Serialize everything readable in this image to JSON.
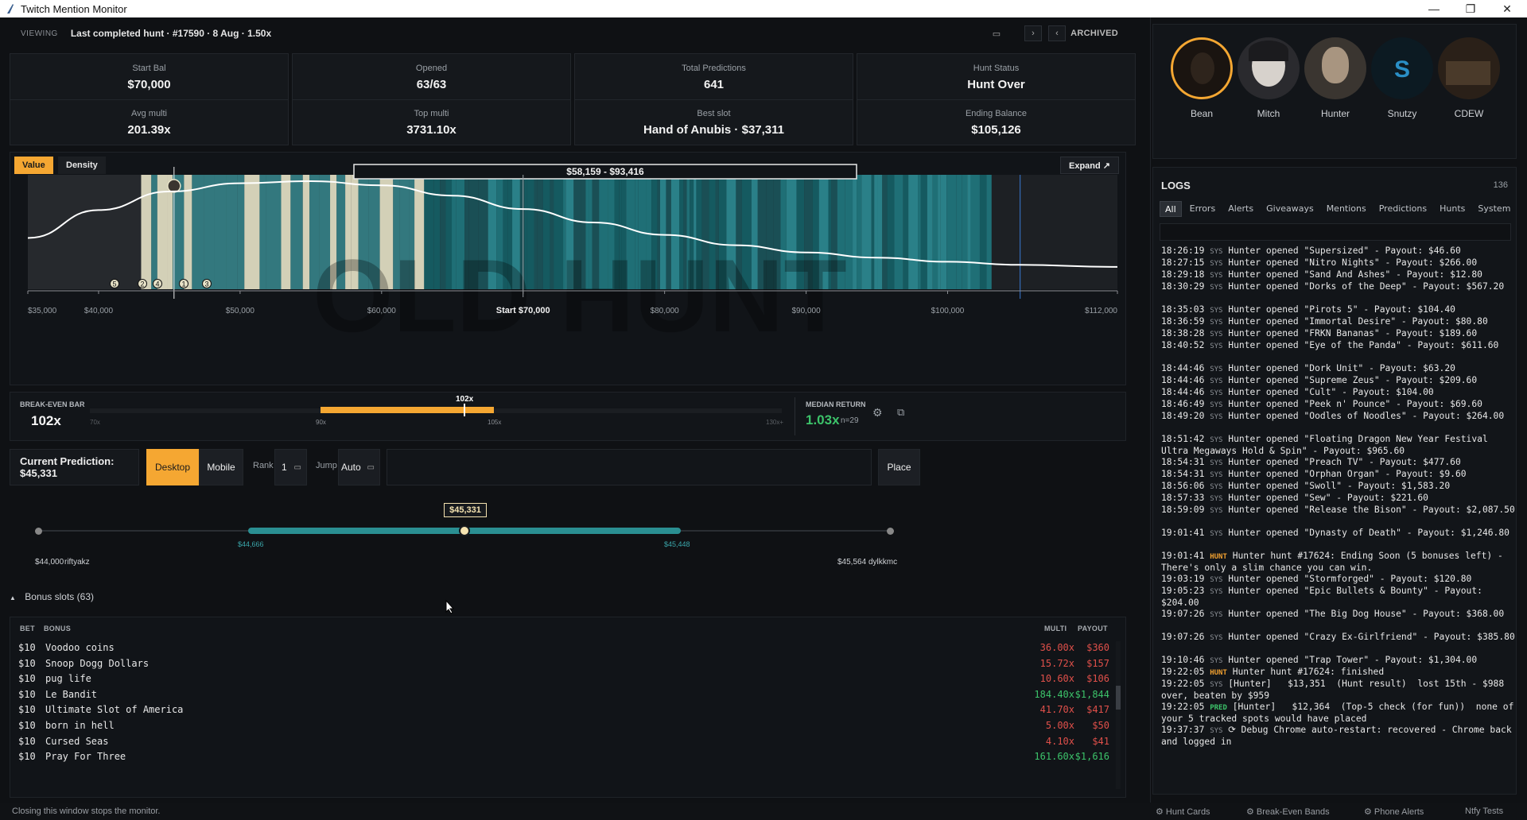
{
  "window": {
    "title": "Twitch Mention Monitor"
  },
  "viewing": {
    "label": "VIEWING",
    "text": "Last completed hunt · #17590 · 8 Aug · 1.50x",
    "archived": "ARCHIVED"
  },
  "stats": [
    {
      "k1": "Start Bal",
      "v1": "$70,000",
      "k2": "Avg multi",
      "v2": "201.39x"
    },
    {
      "k1": "Opened",
      "v1": "63/63",
      "k2": "Top multi",
      "v2": "3731.10x"
    },
    {
      "k1": "Total Predictions",
      "v1": "641",
      "k2": "Best slot",
      "v2": "Hand of Anubis · $37,311"
    },
    {
      "k1": "Hunt Status",
      "v1": "Hunt Over",
      "k2": "Ending Balance",
      "v2": "$105,126"
    }
  ],
  "chart": {
    "toggle_value": "Value",
    "toggle_density": "Density",
    "expand": "Expand ↗",
    "range_label": "$58,159 - $93,416",
    "watermark": "OLD HUNT",
    "ticks": [
      "$35,000",
      "$40,000",
      "$50,000",
      "$60,000",
      "Start $70,000",
      "$80,000",
      "$90,000",
      "$100,000",
      "$112,000"
    ],
    "markers": [
      "5",
      "2",
      "4",
      "1",
      "3"
    ]
  },
  "chart_data": {
    "type": "area",
    "title": "",
    "xlabel": "",
    "ylabel": "",
    "x_range": [
      35000,
      112000
    ],
    "x": [
      35000,
      40000,
      45000,
      50000,
      55000,
      60000,
      65000,
      70000,
      75000,
      80000,
      85000,
      90000,
      95000,
      100000,
      105000,
      112000
    ],
    "series": [
      {
        "values": [
          0.45,
          0.72,
          0.9,
          0.98,
          1.0,
          0.96,
          0.86,
          0.73,
          0.6,
          0.48,
          0.38,
          0.31,
          0.26,
          0.22,
          0.19,
          0.17
        ]
      }
    ],
    "highlight_range": [
      58159,
      93416
    ],
    "start_value": 70000,
    "grid": false
  },
  "breakeven": {
    "label": "BREAK-EVEN BAR",
    "value": "102x",
    "marker": "102x",
    "t1": "70x",
    "t2": "90x",
    "t3": "105x",
    "t4": "130x+",
    "median_label": "MEDIAN RETURN",
    "median_value": "1.03x",
    "median_n": "n=29"
  },
  "prediction": {
    "current": "Current Prediction: $45,331",
    "desktop": "Desktop",
    "mobile": "Mobile",
    "rank_label": "Rank",
    "rank_value": "1",
    "jump_label": "Jump",
    "jump_value": "Auto",
    "input_value": "",
    "place": "Place"
  },
  "slider": {
    "bubble": "$45,331",
    "low_mark": "$44,666",
    "high_mark": "$45,448",
    "left_val": "$44,000",
    "left_user": "riftyakz",
    "right_val": "$45,564",
    "right_user": "dylkkmc",
    "position": 0.5
  },
  "bonus": {
    "header": "Bonus slots",
    "count": "(63)",
    "cols": {
      "bet": "BET",
      "bonus": "BONUS",
      "multi": "MULTI",
      "payout": "PAYOUT"
    },
    "rows": [
      {
        "bet": "$10",
        "name": "Voodoo coins",
        "multi": "36.00x",
        "payout": "$360",
        "good": false
      },
      {
        "bet": "$10",
        "name": "Snoop Dogg Dollars",
        "multi": "15.72x",
        "payout": "$157",
        "good": false
      },
      {
        "bet": "$10",
        "name": "pug life",
        "multi": "10.60x",
        "payout": "$106",
        "good": false
      },
      {
        "bet": "$10",
        "name": "Le Bandit",
        "multi": "184.40x",
        "payout": "$1,844",
        "good": true
      },
      {
        "bet": "$10",
        "name": "Ultimate Slot of America",
        "multi": "41.70x",
        "payout": "$417",
        "good": false
      },
      {
        "bet": "$10",
        "name": "born in hell",
        "multi": "5.00x",
        "payout": "$50",
        "good": false
      },
      {
        "bet": "$10",
        "name": "Cursed Seas",
        "multi": "4.10x",
        "payout": "$41",
        "good": false
      },
      {
        "bet": "$10",
        "name": "Pray For Three",
        "multi": "161.60x",
        "payout": "$1,616",
        "good": true
      }
    ]
  },
  "footer": {
    "note": "Closing this window stops the monitor.",
    "links": [
      "Hunt Cards",
      "Break-Even Bands",
      "Phone Alerts",
      "Ntfy Tests"
    ]
  },
  "avatars": [
    {
      "name": "Bean",
      "active": true,
      "color": "#1a1410"
    },
    {
      "name": "Mitch",
      "active": false,
      "color": "#2a2a2e"
    },
    {
      "name": "Hunter",
      "active": false,
      "color": "#3a3530"
    },
    {
      "name": "Snutzy",
      "active": false,
      "color": "#0c1a22"
    },
    {
      "name": "CDEW",
      "active": false,
      "color": "#2a2018"
    }
  ],
  "logs": {
    "title": "LOGS",
    "count": "136",
    "tabs": [
      "All",
      "Errors",
      "Alerts",
      "Giveaways",
      "Mentions",
      "Predictions",
      "Hunts",
      "System"
    ],
    "lines": [
      {
        "time": "18:26:19",
        "tag": "SYS",
        "text": "Hunter opened \"Supersized\" - Payout: $46.60"
      },
      {
        "time": "18:27:15",
        "tag": "SYS",
        "text": "Hunter opened \"Nitro Nights\" - Payout: $266.00"
      },
      {
        "time": "18:29:18",
        "tag": "SYS",
        "text": "Hunter opened \"Sand And Ashes\" - Payout: $12.80"
      },
      {
        "time": "18:30:29",
        "tag": "SYS",
        "text": "Hunter opened \"Dorks of the Deep\" - Payout: $567.20"
      },
      {
        "time": "18:35:03",
        "tag": "SYS",
        "text": "Hunter opened \"Pirots 5\" - Payout: $104.40"
      },
      {
        "time": "18:36:59",
        "tag": "SYS",
        "text": "Hunter opened \"Immortal Desire\" - Payout: $80.80"
      },
      {
        "time": "18:38:28",
        "tag": "SYS",
        "text": "Hunter opened \"FRKN Bananas\" - Payout: $189.60"
      },
      {
        "time": "18:40:52",
        "tag": "SYS",
        "text": "Hunter opened \"Eye of the Panda\" - Payout: $611.60"
      },
      {
        "time": "18:44:46",
        "tag": "SYS",
        "text": "Hunter opened \"Dork Unit\" - Payout: $63.20"
      },
      {
        "time": "18:44:46",
        "tag": "SYS",
        "text": "Hunter opened \"Supreme Zeus\" - Payout: $209.60"
      },
      {
        "time": "18:44:46",
        "tag": "SYS",
        "text": "Hunter opened \"Cult\" - Payout: $104.00"
      },
      {
        "time": "18:46:49",
        "tag": "SYS",
        "text": "Hunter opened \"Peek n' Pounce\" - Payout: $69.60"
      },
      {
        "time": "18:49:20",
        "tag": "SYS",
        "text": "Hunter opened \"Oodles of Noodles\" - Payout: $264.00"
      },
      {
        "time": "18:51:42",
        "tag": "SYS",
        "text": "Hunter opened \"Floating Dragon New Year Festival Ultra Megaways Hold & Spin\" - Payout: $965.60"
      },
      {
        "time": "18:54:31",
        "tag": "SYS",
        "text": "Hunter opened \"Preach TV\" - Payout: $477.60"
      },
      {
        "time": "18:54:31",
        "tag": "SYS",
        "text": "Hunter opened \"Orphan Organ\" - Payout: $9.60"
      },
      {
        "time": "18:56:06",
        "tag": "SYS",
        "text": "Hunter opened \"Swoll\" - Payout: $1,583.20"
      },
      {
        "time": "18:57:33",
        "tag": "SYS",
        "text": "Hunter opened \"Sew\" - Payout: $221.60"
      },
      {
        "time": "18:59:09",
        "tag": "SYS",
        "text": "Hunter opened \"Release the Bison\" - Payout: $2,087.50"
      },
      {
        "time": "19:01:41",
        "tag": "SYS",
        "text": "Hunter opened \"Dynasty of Death\" - Payout: $1,246.80"
      },
      {
        "time": "19:01:41",
        "tag": "HUNT",
        "text": "Hunter hunt #17624: Ending Soon (5 bonuses left) - There's only a slim chance you can win."
      },
      {
        "time": "19:03:19",
        "tag": "SYS",
        "text": "Hunter opened \"Stormforged\" - Payout: $120.80"
      },
      {
        "time": "19:05:23",
        "tag": "SYS",
        "text": "Hunter opened \"Epic Bullets & Bounty\" - Payout: $204.00"
      },
      {
        "time": "19:07:26",
        "tag": "SYS",
        "text": "Hunter opened \"The Big Dog House\" - Payout: $368.00"
      },
      {
        "time": "19:07:26",
        "tag": "SYS",
        "text": "Hunter opened \"Crazy Ex-Girlfriend\" - Payout: $385.80"
      },
      {
        "time": "19:10:46",
        "tag": "SYS",
        "text": "Hunter opened \"Trap Tower\" - Payout: $1,304.00"
      },
      {
        "time": "19:22:05",
        "tag": "HUNT",
        "text": "Hunter hunt #17624: finished"
      },
      {
        "time": "19:22:05",
        "tag": "SYS",
        "text": "[Hunter]   $13,351  (Hunt result)  lost 15th - $988 over, beaten by $959"
      },
      {
        "time": "19:22:05",
        "tag": "PRED",
        "text": "[Hunter]   $12,364  (Top-5 check (for fun))  none of your 5 tracked spots would have placed"
      },
      {
        "time": "19:37:37",
        "tag": "SYS",
        "text": "⟳ Debug Chrome auto-restart: recovered - Chrome back and logged in"
      }
    ]
  },
  "colors": {
    "accent": "#f5a732",
    "teal": "#1f7f86",
    "good": "#3cc36a",
    "bad": "#e0504a"
  }
}
